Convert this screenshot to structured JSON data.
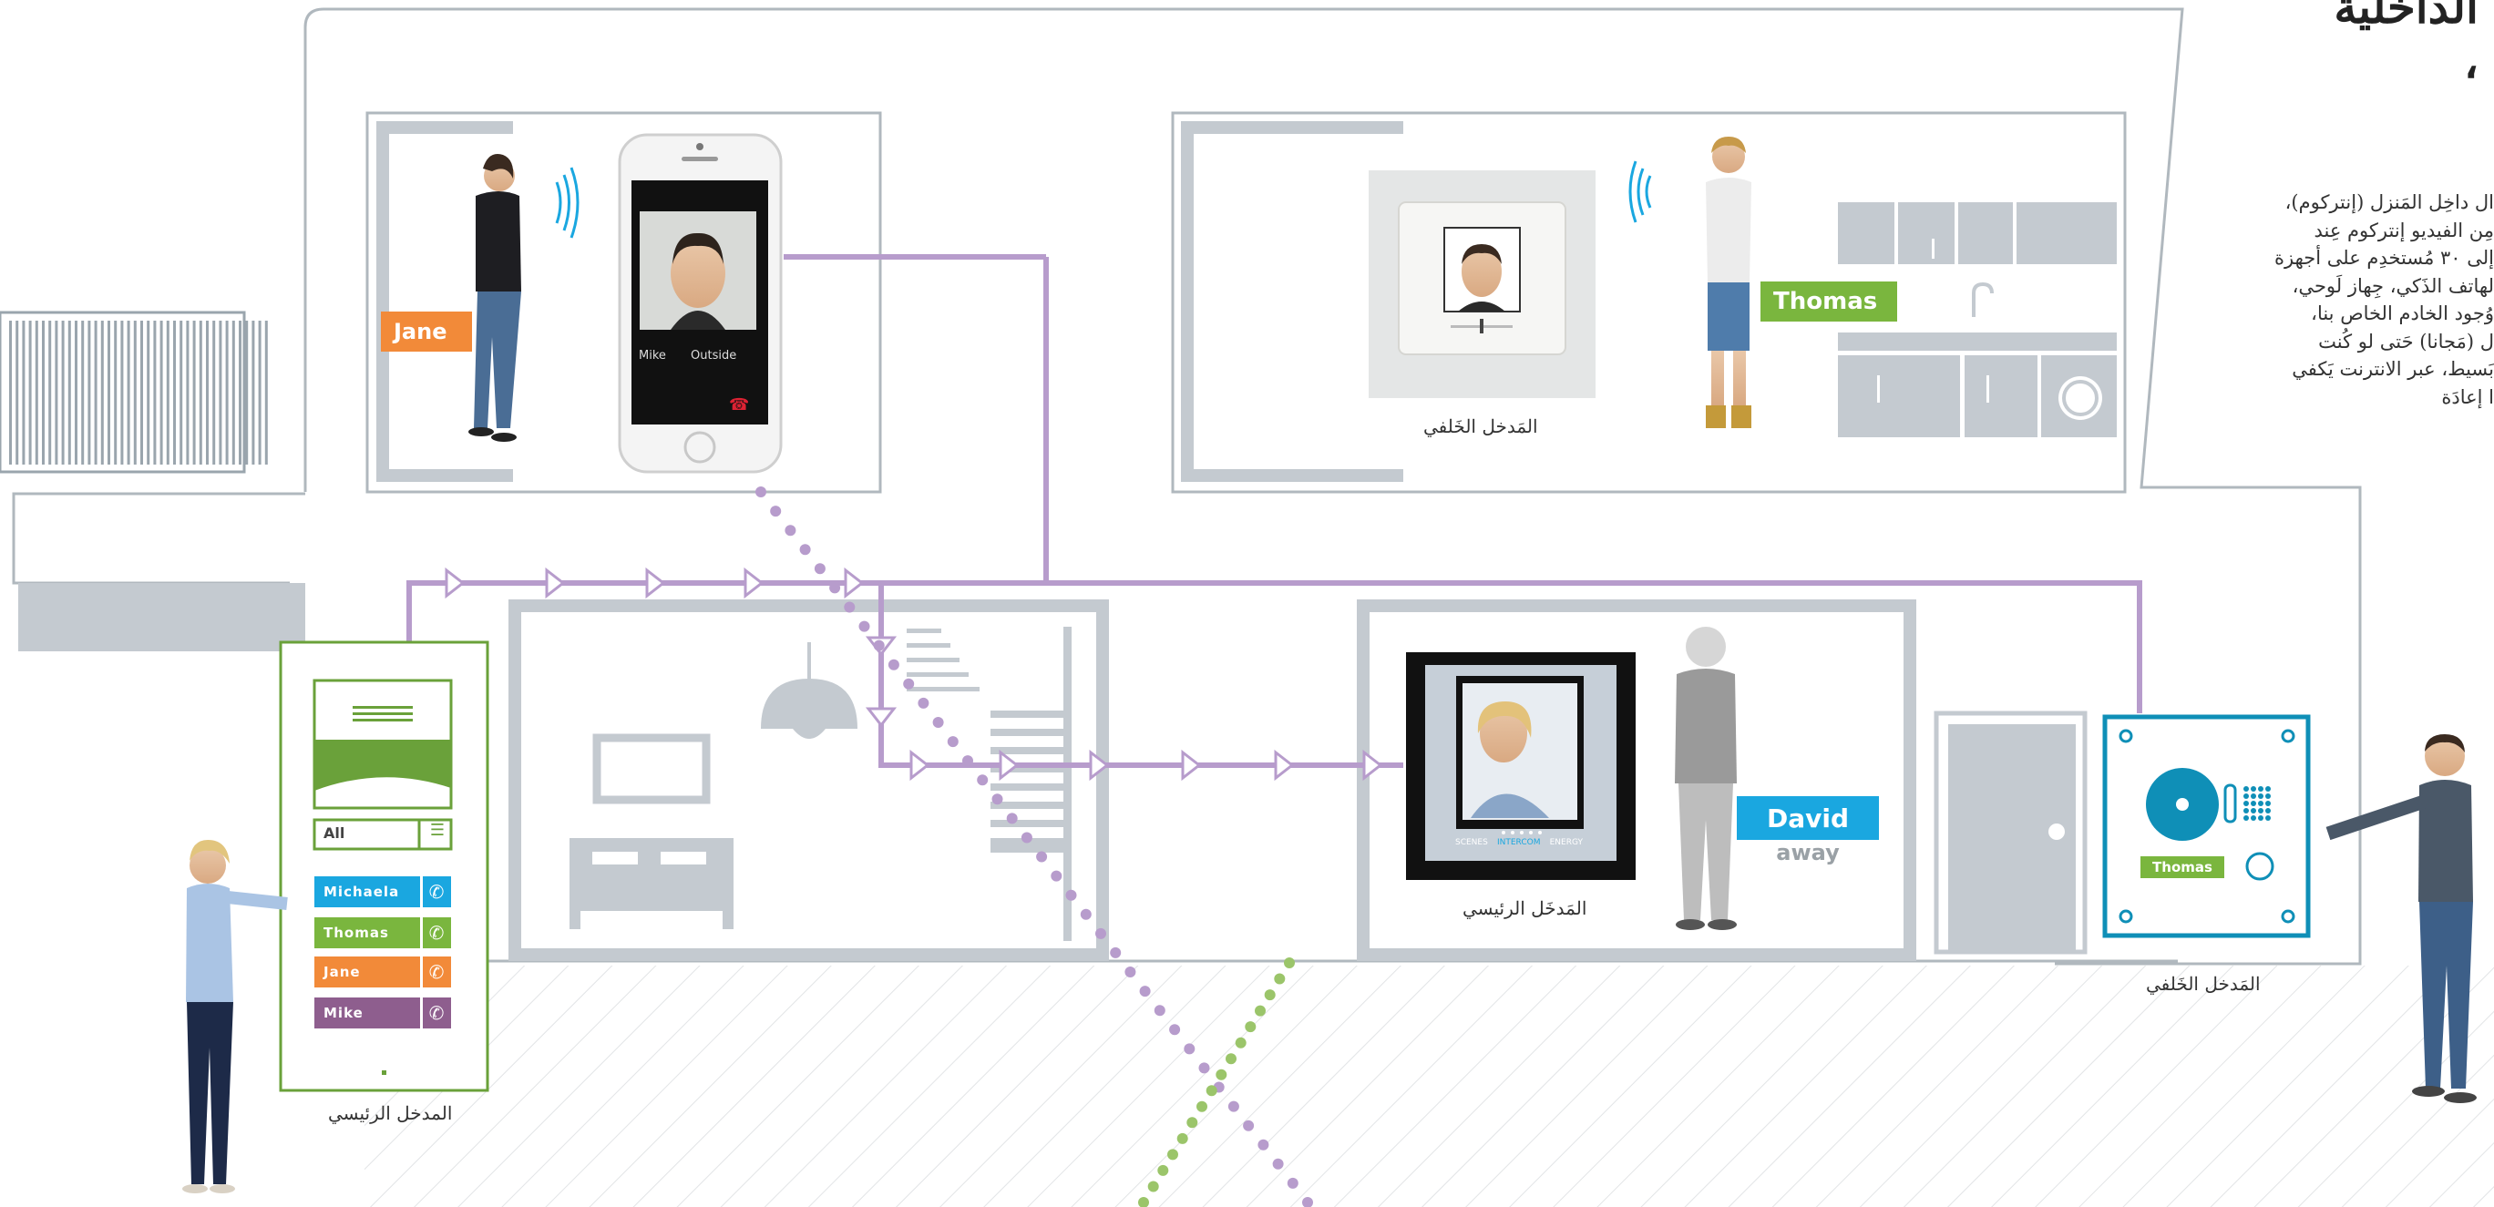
{
  "heading": {
    "line1": "الداخلية",
    "line2": "،"
  },
  "description_lines": [
    "ال داخِل المَنزل (إنتركوم)،",
    "مِن الفيديو إنتركوم عِند",
    "إلى ٣٠ مُستخدِم على أجهزة",
    "لهاتف الذَكي، جِهاز لَوحي،",
    "وُجود الخادم الخاص بنا،",
    "ل (مَجانا) حَتى لو كُنت",
    "بَسيط، عبر الانترنت يَكفي",
    "ا إعادَة"
  ],
  "persons": {
    "jane": "Jane",
    "thomas": "Thomas",
    "david": "David",
    "david_status": "away"
  },
  "smartphone": {
    "caller_name": "Mike",
    "caller_location": "Outside"
  },
  "captions": {
    "back_entrance_panel": "المَدخل الخَلفي",
    "main_entrance_monitor": "المَدخَل الرئيسي",
    "back_entrance_outdoor": "المَدخل الخَلفي",
    "main_entrance_outdoor": "المدخل الرئيسي"
  },
  "main_station": {
    "filter_label": "All",
    "contacts": [
      {
        "name": "Michaela",
        "color": "#1aa7e0"
      },
      {
        "name": "Thomas",
        "color": "#7ab63e"
      },
      {
        "name": "Jane",
        "color": "#f28a39"
      },
      {
        "name": "Mike",
        "color": "#8e5e8e"
      }
    ]
  },
  "indoor_monitor": {
    "tabs": [
      "SCENES",
      "INTERCOM",
      "ENERGY"
    ],
    "active_tab": "INTERCOM"
  },
  "back_door_station": {
    "name_label": "Thomas"
  },
  "colors": {
    "wall": "#c4cad0",
    "wall_outline": "#9aa5ad",
    "bus_line": "#b79ccc",
    "jane_orange": "#f28a39",
    "thomas_green": "#7ab63e",
    "david_blue": "#1aa7e0",
    "station_green": "#6aa13a",
    "door_blue": "#0f8fb7",
    "wifi_blue": "#1aa7e0",
    "purple_dots": "#b79ccc",
    "green_dots": "#9bc56a"
  }
}
